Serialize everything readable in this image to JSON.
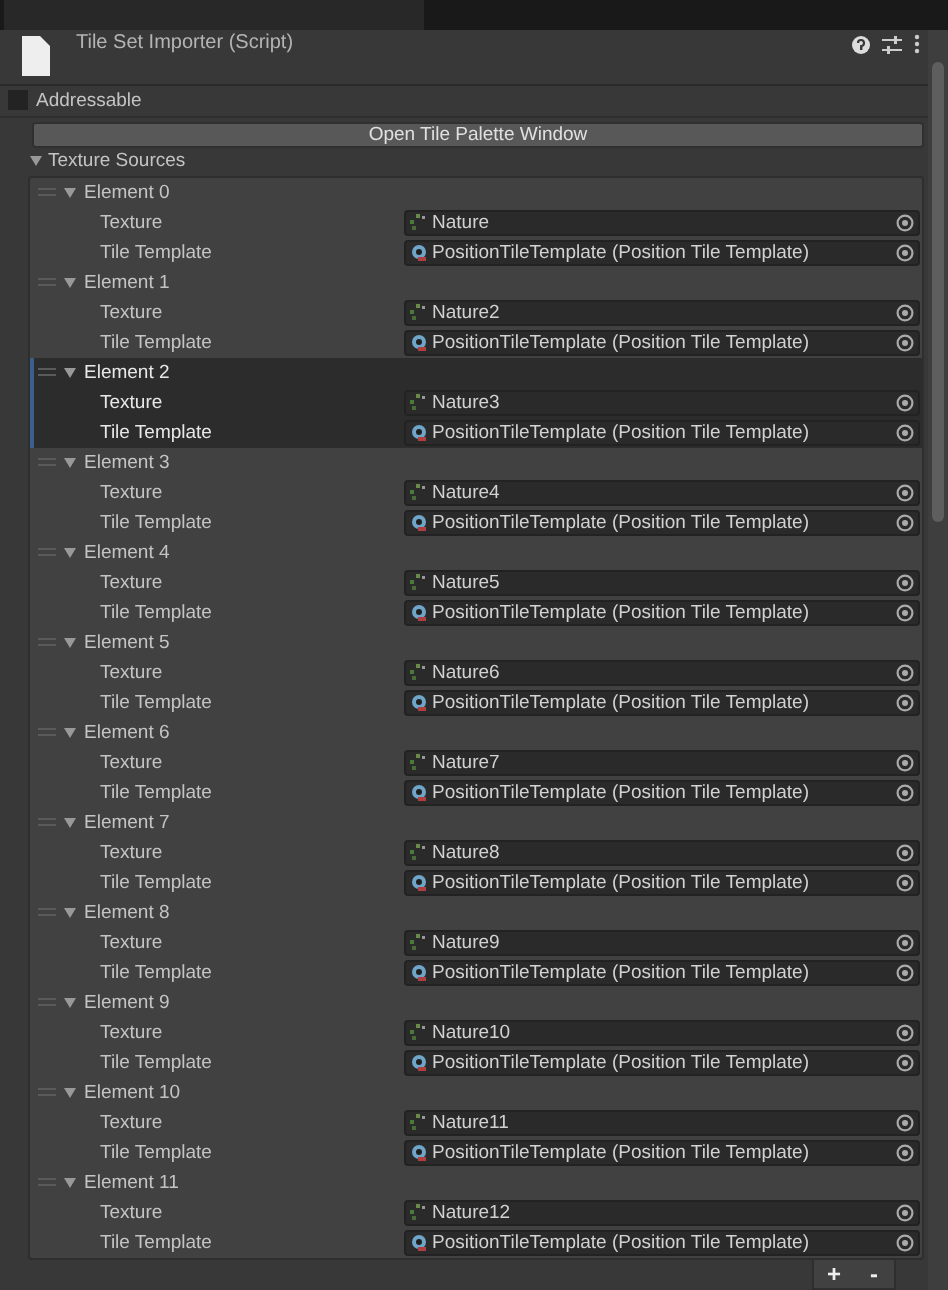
{
  "component": {
    "title": "Tile Set Importer (Script)",
    "expanded": true
  },
  "addressable": {
    "label": "Addressable",
    "checked": false
  },
  "open_button": "Open Tile Palette Window",
  "list": {
    "label": "Texture Sources",
    "expanded": true,
    "elements": [
      {
        "label": "Element 0",
        "expanded": true,
        "selected": false,
        "fields": [
          {
            "label": "Texture",
            "kind": "texture",
            "value": "Nature"
          },
          {
            "label": "Tile Template",
            "kind": "template",
            "value": "PositionTileTemplate (Position Tile Template)"
          }
        ]
      },
      {
        "label": "Element 1",
        "expanded": true,
        "selected": false,
        "fields": [
          {
            "label": "Texture",
            "kind": "texture",
            "value": "Nature2"
          },
          {
            "label": "Tile Template",
            "kind": "template",
            "value": "PositionTileTemplate (Position Tile Template)"
          }
        ]
      },
      {
        "label": "Element 2",
        "expanded": true,
        "selected": true,
        "fields": [
          {
            "label": "Texture",
            "kind": "texture",
            "value": "Nature3"
          },
          {
            "label": "Tile Template",
            "kind": "template",
            "value": "PositionTileTemplate (Position Tile Template)"
          }
        ]
      },
      {
        "label": "Element 3",
        "expanded": true,
        "selected": false,
        "fields": [
          {
            "label": "Texture",
            "kind": "texture",
            "value": "Nature4"
          },
          {
            "label": "Tile Template",
            "kind": "template",
            "value": "PositionTileTemplate (Position Tile Template)"
          }
        ]
      },
      {
        "label": "Element 4",
        "expanded": true,
        "selected": false,
        "fields": [
          {
            "label": "Texture",
            "kind": "texture",
            "value": "Nature5"
          },
          {
            "label": "Tile Template",
            "kind": "template",
            "value": "PositionTileTemplate (Position Tile Template)"
          }
        ]
      },
      {
        "label": "Element 5",
        "expanded": true,
        "selected": false,
        "fields": [
          {
            "label": "Texture",
            "kind": "texture",
            "value": "Nature6"
          },
          {
            "label": "Tile Template",
            "kind": "template",
            "value": "PositionTileTemplate (Position Tile Template)"
          }
        ]
      },
      {
        "label": "Element 6",
        "expanded": true,
        "selected": false,
        "fields": [
          {
            "label": "Texture",
            "kind": "texture",
            "value": "Nature7"
          },
          {
            "label": "Tile Template",
            "kind": "template",
            "value": "PositionTileTemplate (Position Tile Template)"
          }
        ]
      },
      {
        "label": "Element 7",
        "expanded": true,
        "selected": false,
        "fields": [
          {
            "label": "Texture",
            "kind": "texture",
            "value": "Nature8"
          },
          {
            "label": "Tile Template",
            "kind": "template",
            "value": "PositionTileTemplate (Position Tile Template)"
          }
        ]
      },
      {
        "label": "Element 8",
        "expanded": true,
        "selected": false,
        "fields": [
          {
            "label": "Texture",
            "kind": "texture",
            "value": "Nature9"
          },
          {
            "label": "Tile Template",
            "kind": "template",
            "value": "PositionTileTemplate (Position Tile Template)"
          }
        ]
      },
      {
        "label": "Element 9",
        "expanded": true,
        "selected": false,
        "fields": [
          {
            "label": "Texture",
            "kind": "texture",
            "value": "Nature10"
          },
          {
            "label": "Tile Template",
            "kind": "template",
            "value": "PositionTileTemplate (Position Tile Template)"
          }
        ]
      },
      {
        "label": "Element 10",
        "expanded": true,
        "selected": false,
        "fields": [
          {
            "label": "Texture",
            "kind": "texture",
            "value": "Nature11"
          },
          {
            "label": "Tile Template",
            "kind": "template",
            "value": "PositionTileTemplate (Position Tile Template)"
          }
        ]
      },
      {
        "label": "Element 11",
        "expanded": true,
        "selected": false,
        "fields": [
          {
            "label": "Texture",
            "kind": "texture",
            "value": "Nature12"
          },
          {
            "label": "Tile Template",
            "kind": "template",
            "value": "PositionTileTemplate (Position Tile Template)"
          }
        ]
      }
    ],
    "footer_buttons": [
      "+",
      "-"
    ]
  }
}
